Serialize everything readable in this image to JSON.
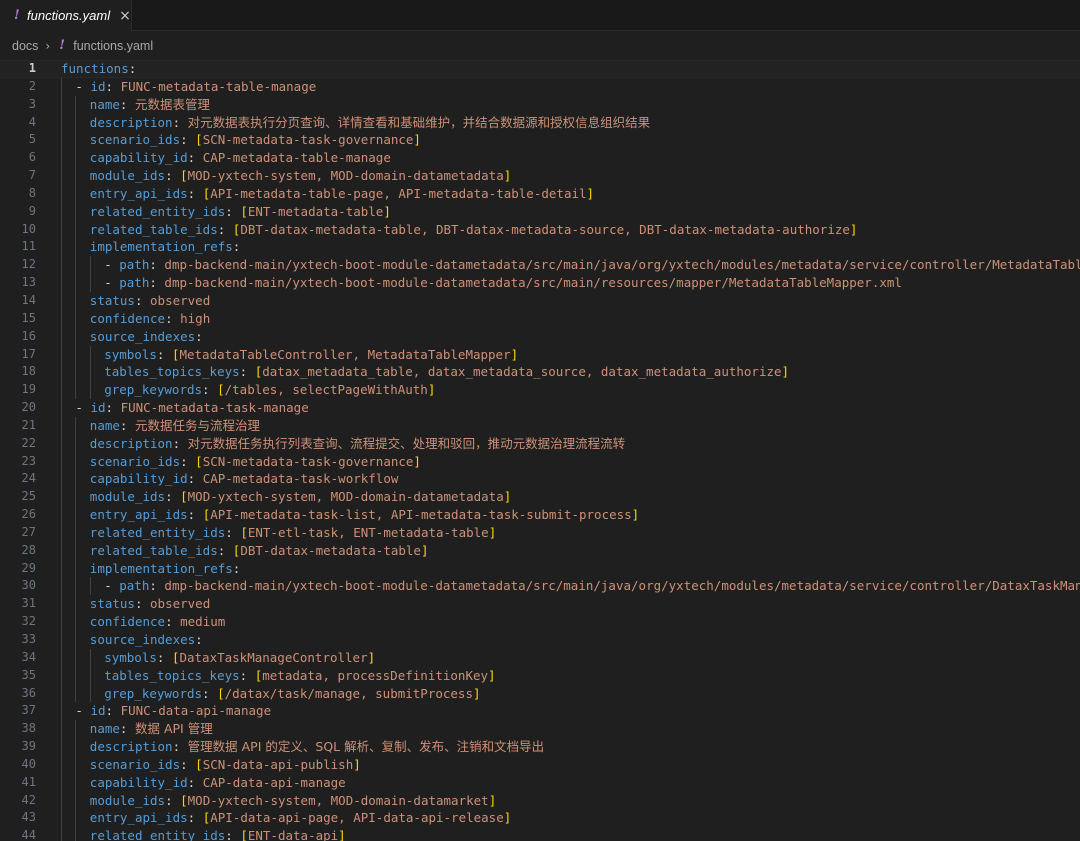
{
  "tab": {
    "icon": "!",
    "icon_name": "yaml-exclamation-icon",
    "label": "functions.yaml",
    "close": "×"
  },
  "breadcrumb": {
    "folder": "docs",
    "separator": "›",
    "icon": "!",
    "file": "functions.yaml"
  },
  "colors": {
    "background": "#1f1f1f",
    "key": "#569cd6",
    "value": "#ce9178",
    "bracket": "#ffd700",
    "line_number": "#6e7681",
    "yaml_icon": "#b180d7"
  },
  "editor": {
    "current_line": 1,
    "lines": [
      {
        "n": "1",
        "indent": 0,
        "dash": false,
        "key": "functions",
        "value": "",
        "list": null
      },
      {
        "n": "2",
        "indent": 2,
        "dash": true,
        "key": "id",
        "value": "FUNC-metadata-table-manage",
        "list": null
      },
      {
        "n": "3",
        "indent": 4,
        "dash": false,
        "key": "name",
        "value": "元数据表管理",
        "list": null
      },
      {
        "n": "4",
        "indent": 4,
        "dash": false,
        "key": "description",
        "value": "对元数据表执行分页查询、详情查看和基础维护，并结合数据源和授权信息组织结果",
        "list": null
      },
      {
        "n": "5",
        "indent": 4,
        "dash": false,
        "key": "scenario_ids",
        "value": "",
        "list": "SCN-metadata-task-governance"
      },
      {
        "n": "6",
        "indent": 4,
        "dash": false,
        "key": "capability_id",
        "value": "CAP-metadata-table-manage",
        "list": null
      },
      {
        "n": "7",
        "indent": 4,
        "dash": false,
        "key": "module_ids",
        "value": "",
        "list": "MOD-yxtech-system, MOD-domain-datametadata"
      },
      {
        "n": "8",
        "indent": 4,
        "dash": false,
        "key": "entry_api_ids",
        "value": "",
        "list": "API-metadata-table-page, API-metadata-table-detail"
      },
      {
        "n": "9",
        "indent": 4,
        "dash": false,
        "key": "related_entity_ids",
        "value": "",
        "list": "ENT-metadata-table"
      },
      {
        "n": "10",
        "indent": 4,
        "dash": false,
        "key": "related_table_ids",
        "value": "",
        "list": "DBT-datax-metadata-table, DBT-datax-metadata-source, DBT-datax-metadata-authorize"
      },
      {
        "n": "11",
        "indent": 4,
        "dash": false,
        "key": "implementation_refs",
        "value": "",
        "list": null
      },
      {
        "n": "12",
        "indent": 6,
        "dash": true,
        "key": "path",
        "value": "dmp-backend-main/yxtech-boot-module-datametadata/src/main/java/org/yxtech/modules/metadata/service/controller/MetadataTableController.java",
        "list": null
      },
      {
        "n": "13",
        "indent": 6,
        "dash": true,
        "key": "path",
        "value": "dmp-backend-main/yxtech-boot-module-datametadata/src/main/resources/mapper/MetadataTableMapper.xml",
        "list": null
      },
      {
        "n": "14",
        "indent": 4,
        "dash": false,
        "key": "status",
        "value": "observed",
        "list": null
      },
      {
        "n": "15",
        "indent": 4,
        "dash": false,
        "key": "confidence",
        "value": "high",
        "list": null
      },
      {
        "n": "16",
        "indent": 4,
        "dash": false,
        "key": "source_indexes",
        "value": "",
        "list": null
      },
      {
        "n": "17",
        "indent": 6,
        "dash": false,
        "key": "symbols",
        "value": "",
        "list": "MetadataTableController, MetadataTableMapper"
      },
      {
        "n": "18",
        "indent": 6,
        "dash": false,
        "key": "tables_topics_keys",
        "value": "",
        "list": "datax_metadata_table, datax_metadata_source, datax_metadata_authorize"
      },
      {
        "n": "19",
        "indent": 6,
        "dash": false,
        "key": "grep_keywords",
        "value": "",
        "list": "/tables, selectPageWithAuth"
      },
      {
        "n": "20",
        "indent": 2,
        "dash": true,
        "key": "id",
        "value": "FUNC-metadata-task-manage",
        "list": null
      },
      {
        "n": "21",
        "indent": 4,
        "dash": false,
        "key": "name",
        "value": "元数据任务与流程治理",
        "list": null
      },
      {
        "n": "22",
        "indent": 4,
        "dash": false,
        "key": "description",
        "value": "对元数据任务执行列表查询、流程提交、处理和驳回，推动元数据治理流程流转",
        "list": null
      },
      {
        "n": "23",
        "indent": 4,
        "dash": false,
        "key": "scenario_ids",
        "value": "",
        "list": "SCN-metadata-task-governance"
      },
      {
        "n": "24",
        "indent": 4,
        "dash": false,
        "key": "capability_id",
        "value": "CAP-metadata-task-workflow",
        "list": null
      },
      {
        "n": "25",
        "indent": 4,
        "dash": false,
        "key": "module_ids",
        "value": "",
        "list": "MOD-yxtech-system, MOD-domain-datametadata"
      },
      {
        "n": "26",
        "indent": 4,
        "dash": false,
        "key": "entry_api_ids",
        "value": "",
        "list": "API-metadata-task-list, API-metadata-task-submit-process"
      },
      {
        "n": "27",
        "indent": 4,
        "dash": false,
        "key": "related_entity_ids",
        "value": "",
        "list": "ENT-etl-task, ENT-metadata-table"
      },
      {
        "n": "28",
        "indent": 4,
        "dash": false,
        "key": "related_table_ids",
        "value": "",
        "list": "DBT-datax-metadata-table"
      },
      {
        "n": "29",
        "indent": 4,
        "dash": false,
        "key": "implementation_refs",
        "value": "",
        "list": null
      },
      {
        "n": "30",
        "indent": 6,
        "dash": true,
        "key": "path",
        "value": "dmp-backend-main/yxtech-boot-module-datametadata/src/main/java/org/yxtech/modules/metadata/service/controller/DataxTaskManageController.java",
        "list": null
      },
      {
        "n": "31",
        "indent": 4,
        "dash": false,
        "key": "status",
        "value": "observed",
        "list": null
      },
      {
        "n": "32",
        "indent": 4,
        "dash": false,
        "key": "confidence",
        "value": "medium",
        "list": null
      },
      {
        "n": "33",
        "indent": 4,
        "dash": false,
        "key": "source_indexes",
        "value": "",
        "list": null
      },
      {
        "n": "34",
        "indent": 6,
        "dash": false,
        "key": "symbols",
        "value": "",
        "list": "DataxTaskManageController"
      },
      {
        "n": "35",
        "indent": 6,
        "dash": false,
        "key": "tables_topics_keys",
        "value": "",
        "list": "metadata, processDefinitionKey"
      },
      {
        "n": "36",
        "indent": 6,
        "dash": false,
        "key": "grep_keywords",
        "value": "",
        "list": "/datax/task/manage, submitProcess"
      },
      {
        "n": "37",
        "indent": 2,
        "dash": true,
        "key": "id",
        "value": "FUNC-data-api-manage",
        "list": null
      },
      {
        "n": "38",
        "indent": 4,
        "dash": false,
        "key": "name",
        "value": "数据 API 管理",
        "list": null
      },
      {
        "n": "39",
        "indent": 4,
        "dash": false,
        "key": "description",
        "value": "管理数据 API 的定义、SQL 解析、复制、发布、注销和文档导出",
        "list": null
      },
      {
        "n": "40",
        "indent": 4,
        "dash": false,
        "key": "scenario_ids",
        "value": "",
        "list": "SCN-data-api-publish"
      },
      {
        "n": "41",
        "indent": 4,
        "dash": false,
        "key": "capability_id",
        "value": "CAP-data-api-manage",
        "list": null
      },
      {
        "n": "42",
        "indent": 4,
        "dash": false,
        "key": "module_ids",
        "value": "",
        "list": "MOD-yxtech-system, MOD-domain-datamarket"
      },
      {
        "n": "43",
        "indent": 4,
        "dash": false,
        "key": "entry_api_ids",
        "value": "",
        "list": "API-data-api-page, API-data-api-release"
      },
      {
        "n": "44",
        "indent": 4,
        "dash": false,
        "key": "related_entity_ids",
        "value": "",
        "list": "ENT-data-api"
      }
    ]
  }
}
